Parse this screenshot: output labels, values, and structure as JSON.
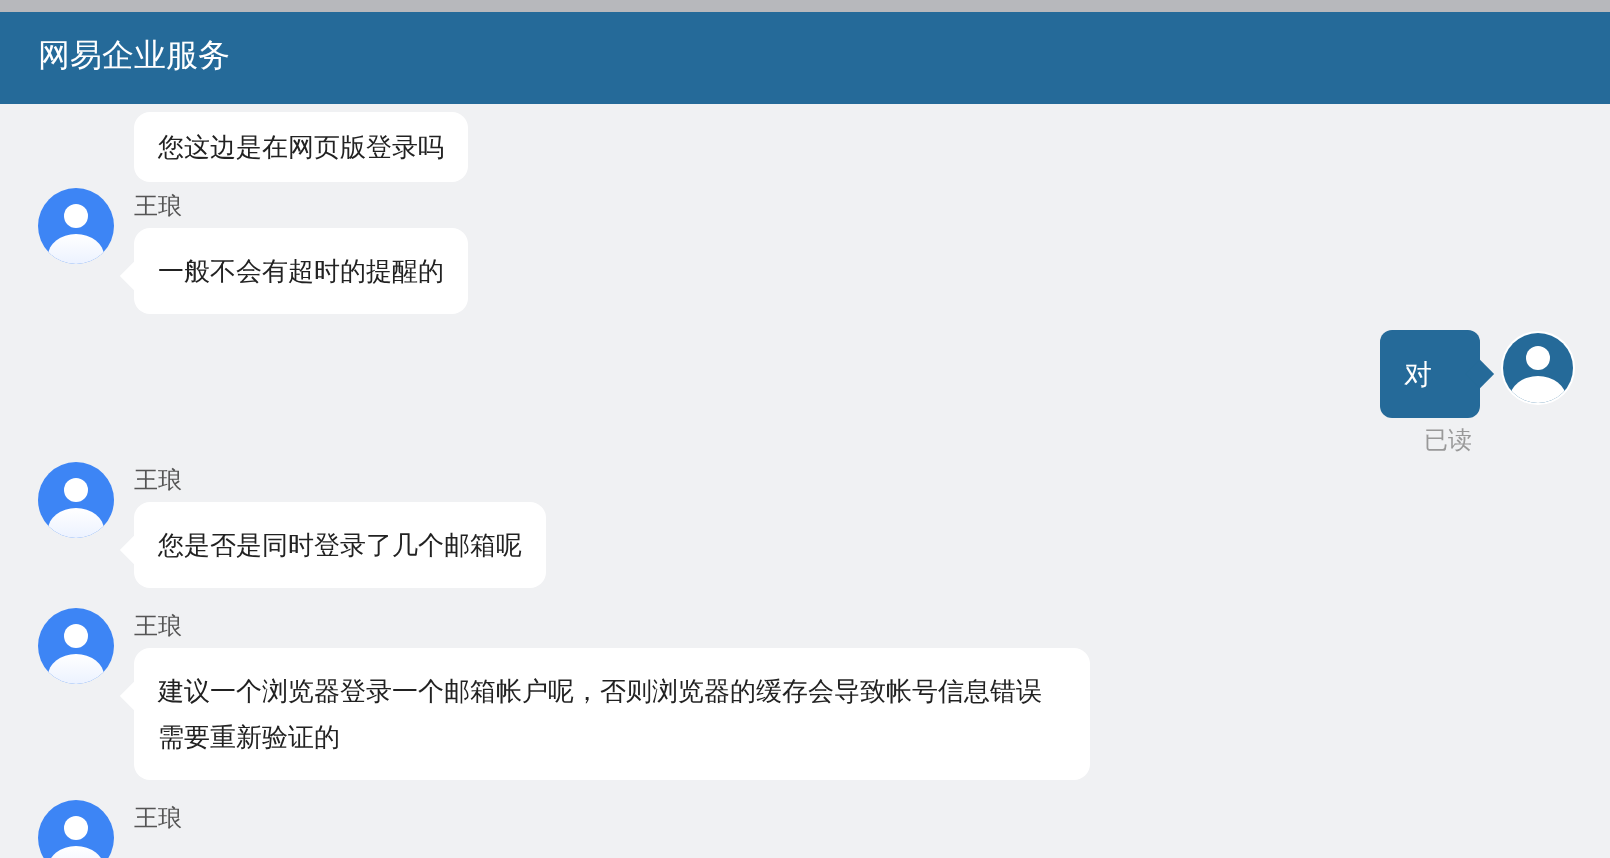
{
  "header": {
    "title": "网易企业服务"
  },
  "messages": [
    {
      "kind": "incoming",
      "text": "您这边是在网页版登录吗"
    },
    {
      "kind": "incoming",
      "sender": "王琅",
      "text": "一般不会有超时的提醒的"
    },
    {
      "kind": "outgoing",
      "text": "对",
      "status": "已读"
    },
    {
      "kind": "incoming",
      "sender": "王琅",
      "text": "您是否是同时登录了几个邮箱呢"
    },
    {
      "kind": "incoming",
      "sender": "王琅",
      "text": "建议一个浏览器登录一个邮箱帐户呢，否则浏览器的缓存会导致帐号信息错误需要重新验证的"
    },
    {
      "kind": "incoming",
      "sender": "王琅"
    }
  ]
}
